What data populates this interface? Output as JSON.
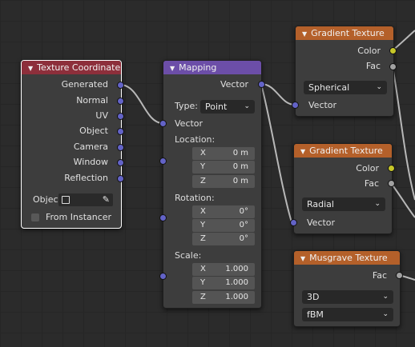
{
  "texture_coordinate": {
    "title": "Texture Coordinate",
    "outputs": [
      "Generated",
      "Normal",
      "UV",
      "Object",
      "Camera",
      "Window",
      "Reflection"
    ],
    "object_label": "Objec",
    "from_instancer": "From Instancer"
  },
  "mapping": {
    "title": "Mapping",
    "output": "Vector",
    "type_label": "Type:",
    "type_value": "Point",
    "vector_input": "Vector",
    "location_label": "Location:",
    "location": [
      {
        "axis": "X",
        "value": "0 m"
      },
      {
        "axis": "Y",
        "value": "0 m"
      },
      {
        "axis": "Z",
        "value": "0 m"
      }
    ],
    "rotation_label": "Rotation:",
    "rotation": [
      {
        "axis": "X",
        "value": "0°"
      },
      {
        "axis": "Y",
        "value": "0°"
      },
      {
        "axis": "Z",
        "value": "0°"
      }
    ],
    "scale_label": "Scale:",
    "scale": [
      {
        "axis": "X",
        "value": "1.000"
      },
      {
        "axis": "Y",
        "value": "1.000"
      },
      {
        "axis": "Z",
        "value": "1.000"
      }
    ]
  },
  "gradient1": {
    "title": "Gradient Texture",
    "color": "Color",
    "fac": "Fac",
    "type": "Spherical",
    "vector": "Vector"
  },
  "gradient2": {
    "title": "Gradient Texture",
    "color": "Color",
    "fac": "Fac",
    "type": "Radial",
    "vector": "Vector"
  },
  "musgrave": {
    "title": "Musgrave Texture",
    "fac": "Fac",
    "dimensions": "3D",
    "musgrave_type": "fBM"
  },
  "colors": {
    "background": "#2b2b2b",
    "node_body": "#3d3d3d",
    "header_input": "#8d2f3b",
    "header_vector": "#6c4ea8",
    "header_texture": "#b4602a",
    "socket_vector": "#6363c7",
    "socket_color": "#c7c729",
    "socket_float": "#a1a1a1",
    "link": "#b8b8b8"
  }
}
